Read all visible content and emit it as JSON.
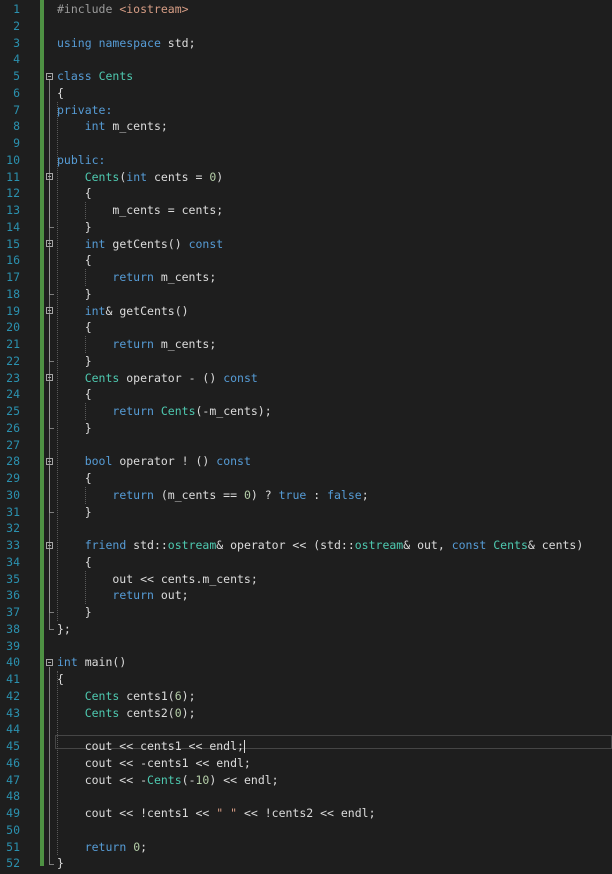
{
  "editor": {
    "language": "cpp",
    "current_line": 45,
    "colors": {
      "background": "#1e1e1e",
      "line_number": "#2b91af",
      "keyword": "#569cd6",
      "type": "#4ec9b0",
      "number": "#b5cea8",
      "string": "#d69d85",
      "preprocessor": "#9b9b9b",
      "text": "#dcdcdc",
      "change_bar": "#57a64a"
    },
    "lines": [
      {
        "n": "1",
        "tokens": [
          {
            "t": "#include ",
            "c": "pp"
          },
          {
            "t": "<iostream>",
            "c": "inc"
          }
        ]
      },
      {
        "n": "2",
        "tokens": []
      },
      {
        "n": "3",
        "tokens": [
          {
            "t": "using",
            "c": "kw"
          },
          {
            "t": " ",
            "c": "txt"
          },
          {
            "t": "namespace",
            "c": "kw"
          },
          {
            "t": " std;",
            "c": "txt"
          }
        ]
      },
      {
        "n": "4",
        "tokens": []
      },
      {
        "n": "5",
        "tokens": [
          {
            "t": "class",
            "c": "kw"
          },
          {
            "t": " ",
            "c": "txt"
          },
          {
            "t": "Cents",
            "c": "ty"
          }
        ]
      },
      {
        "n": "6",
        "tokens": [
          {
            "t": "{",
            "c": "txt"
          }
        ]
      },
      {
        "n": "7",
        "tokens": [
          {
            "t": "private:",
            "c": "kw"
          }
        ]
      },
      {
        "n": "8",
        "tokens": [
          {
            "t": "    ",
            "c": "txt"
          },
          {
            "t": "int",
            "c": "kw"
          },
          {
            "t": " m_cents;",
            "c": "txt"
          }
        ]
      },
      {
        "n": "9",
        "tokens": []
      },
      {
        "n": "10",
        "tokens": [
          {
            "t": "public:",
            "c": "kw"
          }
        ]
      },
      {
        "n": "11",
        "tokens": [
          {
            "t": "    ",
            "c": "txt"
          },
          {
            "t": "Cents",
            "c": "ty"
          },
          {
            "t": "(",
            "c": "txt"
          },
          {
            "t": "int",
            "c": "kw"
          },
          {
            "t": " cents = ",
            "c": "txt"
          },
          {
            "t": "0",
            "c": "num"
          },
          {
            "t": ")",
            "c": "txt"
          }
        ]
      },
      {
        "n": "12",
        "tokens": [
          {
            "t": "    {",
            "c": "txt"
          }
        ]
      },
      {
        "n": "13",
        "tokens": [
          {
            "t": "        m_cents = cents;",
            "c": "txt"
          }
        ]
      },
      {
        "n": "14",
        "tokens": [
          {
            "t": "    }",
            "c": "txt"
          }
        ]
      },
      {
        "n": "15",
        "tokens": [
          {
            "t": "    ",
            "c": "txt"
          },
          {
            "t": "int",
            "c": "kw"
          },
          {
            "t": " getCents() ",
            "c": "txt"
          },
          {
            "t": "const",
            "c": "kw"
          }
        ]
      },
      {
        "n": "16",
        "tokens": [
          {
            "t": "    {",
            "c": "txt"
          }
        ]
      },
      {
        "n": "17",
        "tokens": [
          {
            "t": "        ",
            "c": "txt"
          },
          {
            "t": "return",
            "c": "kw"
          },
          {
            "t": " m_cents;",
            "c": "txt"
          }
        ]
      },
      {
        "n": "18",
        "tokens": [
          {
            "t": "    }",
            "c": "txt"
          }
        ]
      },
      {
        "n": "19",
        "tokens": [
          {
            "t": "    ",
            "c": "txt"
          },
          {
            "t": "int",
            "c": "kw"
          },
          {
            "t": "& getCents()",
            "c": "txt"
          }
        ]
      },
      {
        "n": "20",
        "tokens": [
          {
            "t": "    {",
            "c": "txt"
          }
        ]
      },
      {
        "n": "21",
        "tokens": [
          {
            "t": "        ",
            "c": "txt"
          },
          {
            "t": "return",
            "c": "kw"
          },
          {
            "t": " m_cents;",
            "c": "txt"
          }
        ]
      },
      {
        "n": "22",
        "tokens": [
          {
            "t": "    }",
            "c": "txt"
          }
        ]
      },
      {
        "n": "23",
        "tokens": [
          {
            "t": "    ",
            "c": "txt"
          },
          {
            "t": "Cents",
            "c": "ty"
          },
          {
            "t": " operator - () ",
            "c": "txt"
          },
          {
            "t": "const",
            "c": "kw"
          }
        ]
      },
      {
        "n": "24",
        "tokens": [
          {
            "t": "    {",
            "c": "txt"
          }
        ]
      },
      {
        "n": "25",
        "tokens": [
          {
            "t": "        ",
            "c": "txt"
          },
          {
            "t": "return",
            "c": "kw"
          },
          {
            "t": " ",
            "c": "txt"
          },
          {
            "t": "Cents",
            "c": "ty"
          },
          {
            "t": "(-m_cents);",
            "c": "txt"
          }
        ]
      },
      {
        "n": "26",
        "tokens": [
          {
            "t": "    }",
            "c": "txt"
          }
        ]
      },
      {
        "n": "27",
        "tokens": []
      },
      {
        "n": "28",
        "tokens": [
          {
            "t": "    ",
            "c": "txt"
          },
          {
            "t": "bool",
            "c": "kw"
          },
          {
            "t": " operator ! () ",
            "c": "txt"
          },
          {
            "t": "const",
            "c": "kw"
          }
        ]
      },
      {
        "n": "29",
        "tokens": [
          {
            "t": "    {",
            "c": "txt"
          }
        ]
      },
      {
        "n": "30",
        "tokens": [
          {
            "t": "        ",
            "c": "txt"
          },
          {
            "t": "return",
            "c": "kw"
          },
          {
            "t": " (m_cents == ",
            "c": "txt"
          },
          {
            "t": "0",
            "c": "num"
          },
          {
            "t": ") ? ",
            "c": "txt"
          },
          {
            "t": "true",
            "c": "kw"
          },
          {
            "t": " : ",
            "c": "txt"
          },
          {
            "t": "false",
            "c": "kw"
          },
          {
            "t": ";",
            "c": "txt"
          }
        ]
      },
      {
        "n": "31",
        "tokens": [
          {
            "t": "    }",
            "c": "txt"
          }
        ]
      },
      {
        "n": "32",
        "tokens": []
      },
      {
        "n": "33",
        "tokens": [
          {
            "t": "    ",
            "c": "txt"
          },
          {
            "t": "friend",
            "c": "kw"
          },
          {
            "t": " std::",
            "c": "txt"
          },
          {
            "t": "ostream",
            "c": "ty"
          },
          {
            "t": "& operator << (std::",
            "c": "txt"
          },
          {
            "t": "ostream",
            "c": "ty"
          },
          {
            "t": "& out, ",
            "c": "txt"
          },
          {
            "t": "const",
            "c": "kw"
          },
          {
            "t": " ",
            "c": "txt"
          },
          {
            "t": "Cents",
            "c": "ty"
          },
          {
            "t": "& cents)",
            "c": "txt"
          }
        ]
      },
      {
        "n": "34",
        "tokens": [
          {
            "t": "    {",
            "c": "txt"
          }
        ]
      },
      {
        "n": "35",
        "tokens": [
          {
            "t": "        out << cents.m_cents;",
            "c": "txt"
          }
        ]
      },
      {
        "n": "36",
        "tokens": [
          {
            "t": "        ",
            "c": "txt"
          },
          {
            "t": "return",
            "c": "kw"
          },
          {
            "t": " out;",
            "c": "txt"
          }
        ]
      },
      {
        "n": "37",
        "tokens": [
          {
            "t": "    }",
            "c": "txt"
          }
        ]
      },
      {
        "n": "38",
        "tokens": [
          {
            "t": "};",
            "c": "txt"
          }
        ]
      },
      {
        "n": "39",
        "tokens": []
      },
      {
        "n": "40",
        "tokens": [
          {
            "t": "int",
            "c": "kw"
          },
          {
            "t": " main()",
            "c": "txt"
          }
        ]
      },
      {
        "n": "41",
        "tokens": [
          {
            "t": "{",
            "c": "txt"
          }
        ]
      },
      {
        "n": "42",
        "tokens": [
          {
            "t": "    ",
            "c": "txt"
          },
          {
            "t": "Cents",
            "c": "ty"
          },
          {
            "t": " cents1(",
            "c": "txt"
          },
          {
            "t": "6",
            "c": "num"
          },
          {
            "t": ");",
            "c": "txt"
          }
        ]
      },
      {
        "n": "43",
        "tokens": [
          {
            "t": "    ",
            "c": "txt"
          },
          {
            "t": "Cents",
            "c": "ty"
          },
          {
            "t": " cents2(",
            "c": "txt"
          },
          {
            "t": "0",
            "c": "num"
          },
          {
            "t": ");",
            "c": "txt"
          }
        ]
      },
      {
        "n": "44",
        "tokens": []
      },
      {
        "n": "45",
        "tokens": [
          {
            "t": "    cout << cents1 << endl;",
            "c": "txt"
          }
        ]
      },
      {
        "n": "46",
        "tokens": [
          {
            "t": "    cout << -cents1 << endl;",
            "c": "txt"
          }
        ]
      },
      {
        "n": "47",
        "tokens": [
          {
            "t": "    cout << -",
            "c": "txt"
          },
          {
            "t": "Cents",
            "c": "ty"
          },
          {
            "t": "(-",
            "c": "txt"
          },
          {
            "t": "10",
            "c": "num"
          },
          {
            "t": ") << endl;",
            "c": "txt"
          }
        ]
      },
      {
        "n": "48",
        "tokens": []
      },
      {
        "n": "49",
        "tokens": [
          {
            "t": "    cout << !cents1 << ",
            "c": "txt"
          },
          {
            "t": "\" \"",
            "c": "str"
          },
          {
            "t": " << !cents2 << endl;",
            "c": "txt"
          }
        ]
      },
      {
        "n": "50",
        "tokens": []
      },
      {
        "n": "51",
        "tokens": [
          {
            "t": "    ",
            "c": "txt"
          },
          {
            "t": "return",
            "c": "kw"
          },
          {
            "t": " ",
            "c": "txt"
          },
          {
            "t": "0",
            "c": "num"
          },
          {
            "t": ";",
            "c": "txt"
          }
        ]
      },
      {
        "n": "52",
        "tokens": [
          {
            "t": "}",
            "c": "txt"
          }
        ]
      }
    ]
  }
}
